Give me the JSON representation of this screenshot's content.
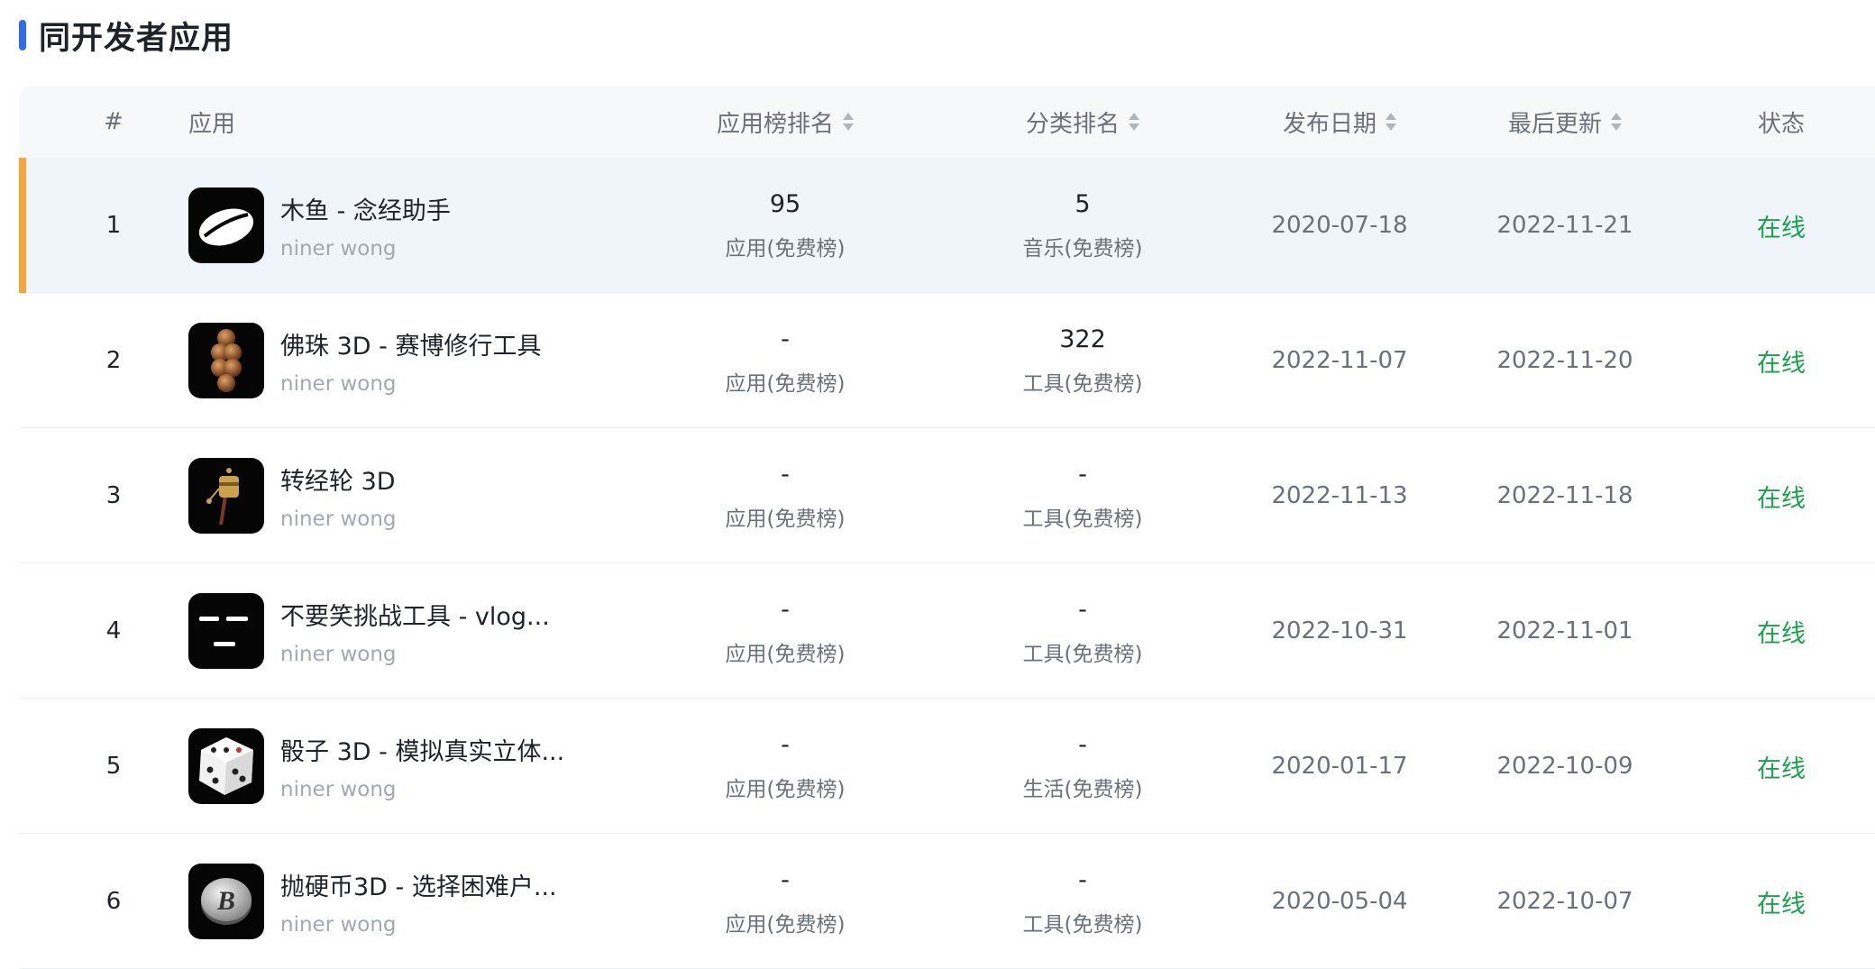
{
  "section": {
    "title": "同开发者应用"
  },
  "table": {
    "headers": {
      "index": "#",
      "app": "应用",
      "app_rank": "应用榜排名",
      "category_rank": "分类排名",
      "release_date": "发布日期",
      "last_update": "最后更新",
      "status": "状态"
    },
    "rows": [
      {
        "index": "1",
        "name": "木鱼 - 念经助手",
        "developer": "niner wong",
        "app_rank": "95",
        "app_rank_cat": "应用(免费榜)",
        "cat_rank": "5",
        "cat_rank_cat": "音乐(免费榜)",
        "release": "2020-07-18",
        "updated": "2022-11-21",
        "status": "在线",
        "icon": "wooden-fish-icon"
      },
      {
        "index": "2",
        "name": "佛珠 3D - 赛博修行工具",
        "developer": "niner wong",
        "app_rank": "-",
        "app_rank_cat": "应用(免费榜)",
        "cat_rank": "322",
        "cat_rank_cat": "工具(免费榜)",
        "release": "2022-11-07",
        "updated": "2022-11-20",
        "status": "在线",
        "icon": "prayer-beads-icon"
      },
      {
        "index": "3",
        "name": "转经轮 3D",
        "developer": "niner wong",
        "app_rank": "-",
        "app_rank_cat": "应用(免费榜)",
        "cat_rank": "-",
        "cat_rank_cat": "工具(免费榜)",
        "release": "2022-11-13",
        "updated": "2022-11-18",
        "status": "在线",
        "icon": "prayer-wheel-icon"
      },
      {
        "index": "4",
        "name": "不要笑挑战工具 - vlog...",
        "developer": "niner wong",
        "app_rank": "-",
        "app_rank_cat": "应用(免费榜)",
        "cat_rank": "-",
        "cat_rank_cat": "工具(免费榜)",
        "release": "2022-10-31",
        "updated": "2022-11-01",
        "status": "在线",
        "icon": "straight-face-icon"
      },
      {
        "index": "5",
        "name": "骰子 3D - 模拟真实立体...",
        "developer": "niner wong",
        "app_rank": "-",
        "app_rank_cat": "应用(免费榜)",
        "cat_rank": "-",
        "cat_rank_cat": "生活(免费榜)",
        "release": "2020-01-17",
        "updated": "2022-10-09",
        "status": "在线",
        "icon": "dice-icon"
      },
      {
        "index": "6",
        "name": "抛硬币3D - 选择困难户...",
        "developer": "niner wong",
        "app_rank": "-",
        "app_rank_cat": "应用(免费榜)",
        "cat_rank": "-",
        "cat_rank_cat": "工具(免费榜)",
        "release": "2020-05-04",
        "updated": "2022-10-07",
        "status": "在线",
        "icon": "coin-icon"
      }
    ]
  },
  "colors": {
    "accent": "#2f6bf0",
    "highlight": "#f7a53a",
    "online": "#17a34a"
  }
}
